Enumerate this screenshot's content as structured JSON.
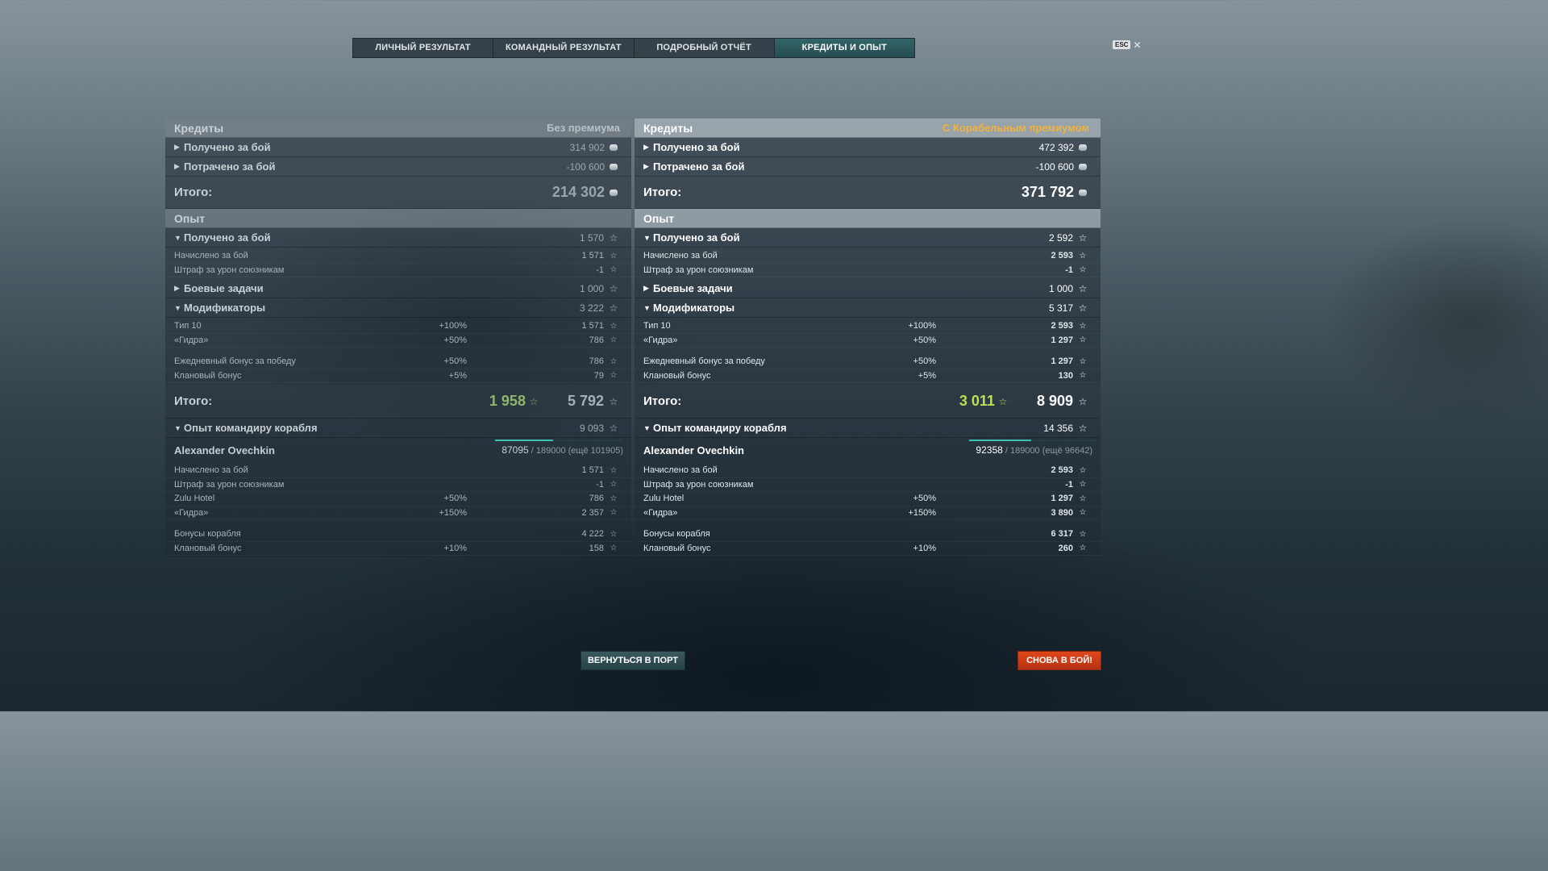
{
  "tabs": [
    "ЛИЧНЫЙ РЕЗУЛЬТАТ",
    "КОМАНДНЫЙ РЕЗУЛЬТАТ",
    "ПОДРОБНЫЙ ОТЧЁТ",
    "КРЕДИТЫ И ОПЫТ"
  ],
  "active_tab": "КРЕДИТЫ И ОПЫТ",
  "esc_label": "ESC",
  "left": {
    "credits_title": "Кредиты",
    "premium_label": "Без премиума",
    "credits_earned_label": "Получено за бой",
    "credits_earned": "314 902",
    "credits_spent_label": "Потрачено за бой",
    "credits_spent": "-100 600",
    "credits_total_label": "Итого:",
    "credits_total": "214 302",
    "xp_title": "Опыт",
    "xp_earned_label": "Получено за бой",
    "xp_earned": "1 570",
    "xp_accrued_label": "Начислено за бой",
    "xp_accrued": "1 571",
    "xp_penalty_label": "Штраф за урон союзникам",
    "xp_penalty": "-1",
    "missions_label": "Боевые задачи",
    "missions": "1 000",
    "modifiers_label": "Модификаторы",
    "modifiers": "3 222",
    "mods": [
      {
        "label": "Тип 10",
        "pct": "+100%",
        "val": "1 571"
      },
      {
        "label": "«Гидра»",
        "pct": "+50%",
        "val": "786"
      },
      {
        "label": "Ежедневный бонус за победу",
        "pct": "+50%",
        "val": "786"
      },
      {
        "label": "Клановый бонус",
        "pct": "+5%",
        "val": "79"
      }
    ],
    "xp_total_label": "Итого:",
    "xp_total_ship": "1 958",
    "xp_total": "5 792",
    "commander_label": "Опыт командиру корабля",
    "commander_xp": "9 093",
    "commander_name": "Alexander Ovechkin",
    "commander_progress_current": "87095",
    "commander_progress_rest": "/ 189000 (ещё 101905)",
    "commander_progress_fraction": 0.46,
    "cmd_rows": [
      {
        "label": "Начислено за бой",
        "pct": "",
        "val": "1 571"
      },
      {
        "label": "Штраф за урон союзникам",
        "pct": "",
        "val": "-1"
      },
      {
        "label": "Zulu Hotel",
        "pct": "+50%",
        "val": "786"
      },
      {
        "label": "«Гидра»",
        "pct": "+150%",
        "val": "2 357"
      },
      {
        "label": "Бонусы корабля",
        "pct": "",
        "val": "4 222"
      },
      {
        "label": "Клановый бонус",
        "pct": "+10%",
        "val": "158"
      }
    ]
  },
  "right": {
    "credits_title": "Кредиты",
    "premium_label": "С Корабельным премиумом",
    "credits_earned_label": "Получено за бой",
    "credits_earned": "472 392",
    "credits_spent_label": "Потрачено за бой",
    "credits_spent": "-100 600",
    "credits_total_label": "Итого:",
    "credits_total": "371 792",
    "xp_title": "Опыт",
    "xp_earned_label": "Получено за бой",
    "xp_earned": "2 592",
    "xp_accrued_label": "Начислено за бой",
    "xp_accrued": "2 593",
    "xp_penalty_label": "Штраф за урон союзникам",
    "xp_penalty": "-1",
    "missions_label": "Боевые задачи",
    "missions": "1 000",
    "modifiers_label": "Модификаторы",
    "modifiers": "5 317",
    "mods": [
      {
        "label": "Тип 10",
        "pct": "+100%",
        "val": "2 593"
      },
      {
        "label": "«Гидра»",
        "pct": "+50%",
        "val": "1 297"
      },
      {
        "label": "Ежедневный бонус за победу",
        "pct": "+50%",
        "val": "1 297"
      },
      {
        "label": "Клановый бонус",
        "pct": "+5%",
        "val": "130"
      }
    ],
    "xp_total_label": "Итого:",
    "xp_total_ship": "3 011",
    "xp_total": "8 909",
    "commander_label": "Опыт командиру корабля",
    "commander_xp": "14 356",
    "commander_name": "Alexander Ovechkin",
    "commander_progress_current": "92358",
    "commander_progress_rest": "/ 189000 (ещё 96642)",
    "commander_progress_fraction": 0.49,
    "cmd_rows": [
      {
        "label": "Начислено за бой",
        "pct": "",
        "val": "2 593"
      },
      {
        "label": "Штраф за урон союзникам",
        "pct": "",
        "val": "-1"
      },
      {
        "label": "Zulu Hotel",
        "pct": "+50%",
        "val": "1 297"
      },
      {
        "label": "«Гидра»",
        "pct": "+150%",
        "val": "3 890"
      },
      {
        "label": "Бонусы корабля",
        "pct": "",
        "val": "6 317"
      },
      {
        "label": "Клановый бонус",
        "pct": "+10%",
        "val": "260"
      }
    ]
  },
  "buttons": {
    "return_port": "ВЕРНУТЬСЯ В ПОРТ",
    "to_battle": "СНОВА В БОЙ!"
  },
  "icons": {
    "expand_collapsed": "arrow-right-icon",
    "expand_open": "arrow-down-icon",
    "credits": "credit-coin-icon",
    "xp": "star-icon",
    "close": "close-icon"
  },
  "colors": {
    "active_tab": "#2a575c",
    "premium_text": "#f2b23c",
    "xp_green_left": "#8fb86a",
    "xp_green_right": "#b9e05a",
    "battle_button": "#d0401a"
  }
}
